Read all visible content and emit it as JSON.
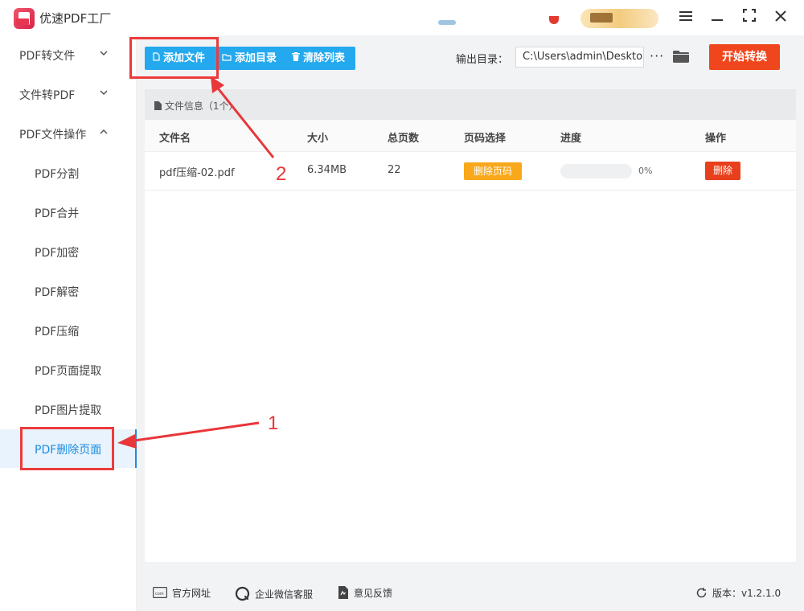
{
  "app": {
    "title": "优速PDF工厂"
  },
  "window_controls": [
    "menu-icon",
    "minimize-icon",
    "maximize-icon",
    "close-icon"
  ],
  "sidebar": {
    "groups": [
      {
        "label": "PDF转文件",
        "expanded": false
      },
      {
        "label": "文件转PDF",
        "expanded": false
      },
      {
        "label": "PDF文件操作",
        "expanded": true
      }
    ],
    "items": [
      "PDF分割",
      "PDF合并",
      "PDF加密",
      "PDF解密",
      "PDF压缩",
      "PDF页面提取",
      "PDF图片提取",
      "PDF删除页面"
    ],
    "active": "PDF删除页面"
  },
  "toolbar": {
    "add_file": "添加文件",
    "add_folder": "添加目录",
    "clear_list": "清除列表",
    "output_label": "输出目录：",
    "output_path": "C:\\Users\\admin\\Deskto",
    "more": "···",
    "start": "开始转换"
  },
  "file_panel": {
    "header": "文件信息（1个）",
    "columns": [
      "文件名",
      "大小",
      "总页数",
      "页码选择",
      "进度",
      "操作"
    ],
    "rows": [
      {
        "name": "pdf压缩-02.pdf",
        "size": "6.34MB",
        "pages": "22",
        "page_select": "删除页码",
        "progress": 0,
        "progress_text": "0%",
        "action": "删除"
      }
    ]
  },
  "footer": {
    "website": "官方网址",
    "wechat": "企业微信客服",
    "feedback": "意见反馈",
    "version": "版本：v1.2.1.0"
  },
  "annotations": {
    "step1": "1",
    "step2": "2",
    "color": "#e8363a"
  },
  "colors": {
    "accent": "#24a9ef",
    "start": "#f0461e",
    "page_select": "#f8a81a",
    "delete": "#e8401c",
    "active_side": "#1d8ce0"
  }
}
